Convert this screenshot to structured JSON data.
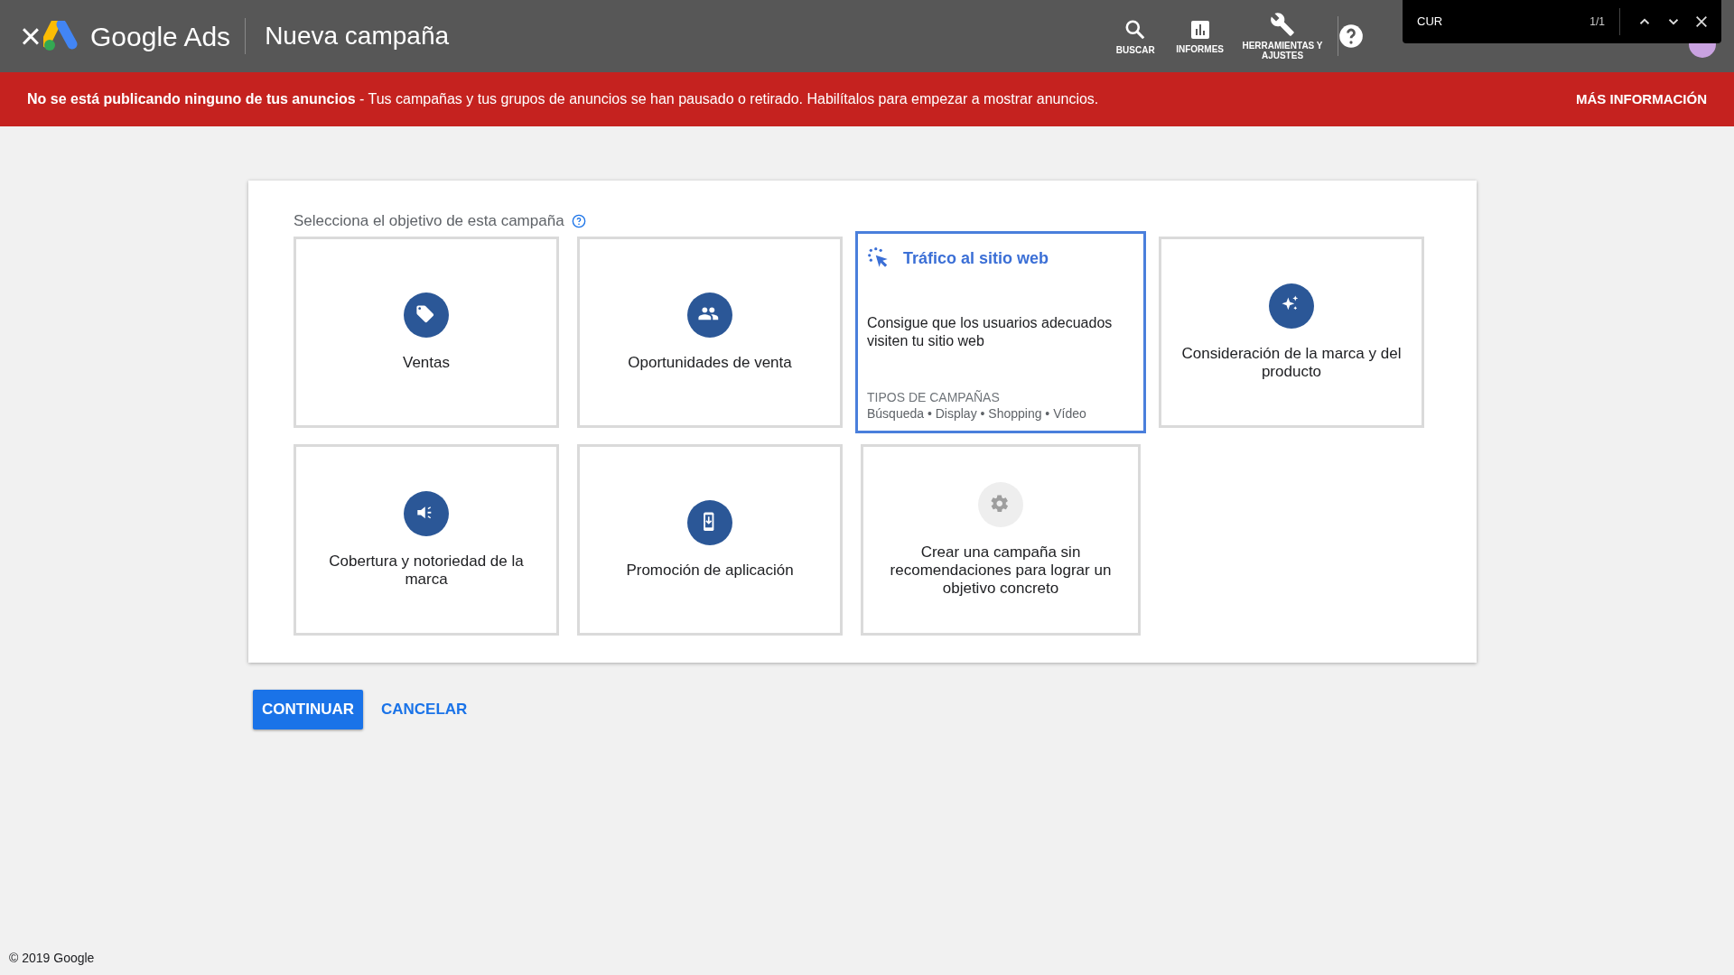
{
  "header": {
    "close": "×",
    "product": "Google Ads",
    "title": "Nueva campaña",
    "tools": [
      {
        "kind": "search",
        "label": "BUSCAR"
      },
      {
        "kind": "chart",
        "label": "INFORMES"
      },
      {
        "kind": "wrench",
        "label": "HERRAMIENTAS Y AJUSTES"
      }
    ]
  },
  "find_bar": {
    "query": "CUR",
    "count": "1/1"
  },
  "alert": {
    "text": "**No se está publicando ninguno de tus anuncios** - Tus campañas y tus grupos de anuncios se han pausado o retirado. Habilítalos para empezar a mostrar anuncios.",
    "action": "MÁS INFORMACIÓN"
  },
  "panel": {
    "heading": "Selecciona el objetivo de esta campaña",
    "cards": [
      {
        "kind": "tag",
        "label": "Ventas",
        "selected": false
      },
      {
        "kind": "people",
        "label": "Oportunidades de venta",
        "selected": false
      },
      {
        "kind": "cursor",
        "label": "Tráfico al sitio web",
        "selected": true,
        "description": "Consigue que los usuarios adecuados visiten tu sitio web",
        "types_label": "TIPOS DE CAMPAÑAS",
        "types": "Búsqueda • Display • Shopping • Vídeo"
      },
      {
        "kind": "sparkle",
        "label": "Consideración de la marca y del producto",
        "selected": false
      },
      {
        "kind": "speaker",
        "label": "Cobertura y notoriedad de la marca",
        "selected": false
      },
      {
        "kind": "phone",
        "label": "Promoción de aplicación",
        "selected": false
      },
      {
        "kind": "gear",
        "label": "Crear una campaña sin recomendaciones para lograr un objetivo concreto",
        "selected": false
      }
    ]
  },
  "buttons": {
    "primary": "CONTINUAR",
    "secondary": "CANCELAR"
  },
  "footer": "© 2019 Google"
}
